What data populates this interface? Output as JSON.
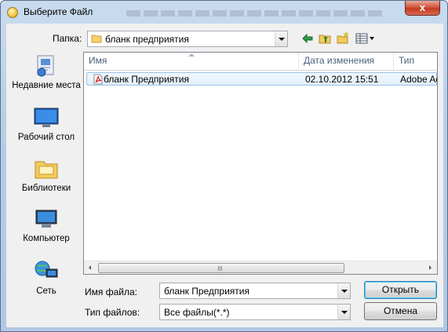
{
  "window": {
    "title": "Выберите Файл",
    "close_glyph": "x"
  },
  "top": {
    "folder_label": "Папка:",
    "folder_value": "бланк предприятия"
  },
  "toolbar": [
    "back-arrow-icon",
    "up-folder-icon",
    "new-folder-icon",
    "view-menu-icon"
  ],
  "places": [
    {
      "label": "Недавние места",
      "icon": "recent-places-icon"
    },
    {
      "label": "Рабочий стол",
      "icon": "desktop-icon"
    },
    {
      "label": "Библиотеки",
      "icon": "libraries-icon"
    },
    {
      "label": "Компьютер",
      "icon": "computer-icon"
    },
    {
      "label": "Сеть",
      "icon": "network-icon"
    }
  ],
  "filelist": {
    "columns": [
      "Имя",
      "Дата изменения",
      "Тип"
    ],
    "rows": [
      {
        "name": "бланк Предприятия",
        "date": "02.10.2012 15:51",
        "type": "Adobe Ac",
        "icon": "pdf-file-icon"
      }
    ],
    "scrollbar_grip": "III"
  },
  "bottom": {
    "filename_label": "Имя файла:",
    "filename_value": "бланк Предприятия",
    "filetype_label": "Тип файлов:",
    "filetype_value": "Все файлы(*.*)",
    "open_label": "Открыть",
    "cancel_label": "Отмена"
  },
  "colors": {
    "accent": "#3c7fb1",
    "selection": "#e1effa",
    "close": "#c43b22"
  }
}
